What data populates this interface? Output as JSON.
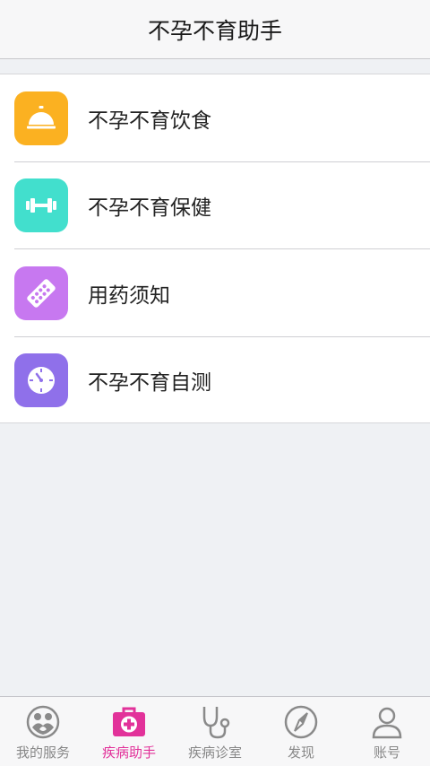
{
  "header": {
    "title": "不孕不育助手"
  },
  "menu": {
    "items": [
      {
        "label": "不孕不育饮食",
        "icon": "service-bell-icon",
        "color": "#fbb121"
      },
      {
        "label": "不孕不育保健",
        "icon": "dumbbell-icon",
        "color": "#42dfcd"
      },
      {
        "label": "用药须知",
        "icon": "pill-pack-icon",
        "color": "#c778f0"
      },
      {
        "label": "不孕不育自测",
        "icon": "stopwatch-icon",
        "color": "#8f70ea"
      }
    ]
  },
  "tabbar": {
    "items": [
      {
        "label": "我的服务",
        "icon": "mother-baby-icon",
        "active": false
      },
      {
        "label": "疾病助手",
        "icon": "medical-kit-icon",
        "active": true
      },
      {
        "label": "疾病诊室",
        "icon": "stethoscope-icon",
        "active": false
      },
      {
        "label": "发现",
        "icon": "compass-icon",
        "active": false
      },
      {
        "label": "账号",
        "icon": "user-icon",
        "active": false
      }
    ],
    "active_color": "#e2329a",
    "inactive_color": "#888888"
  }
}
